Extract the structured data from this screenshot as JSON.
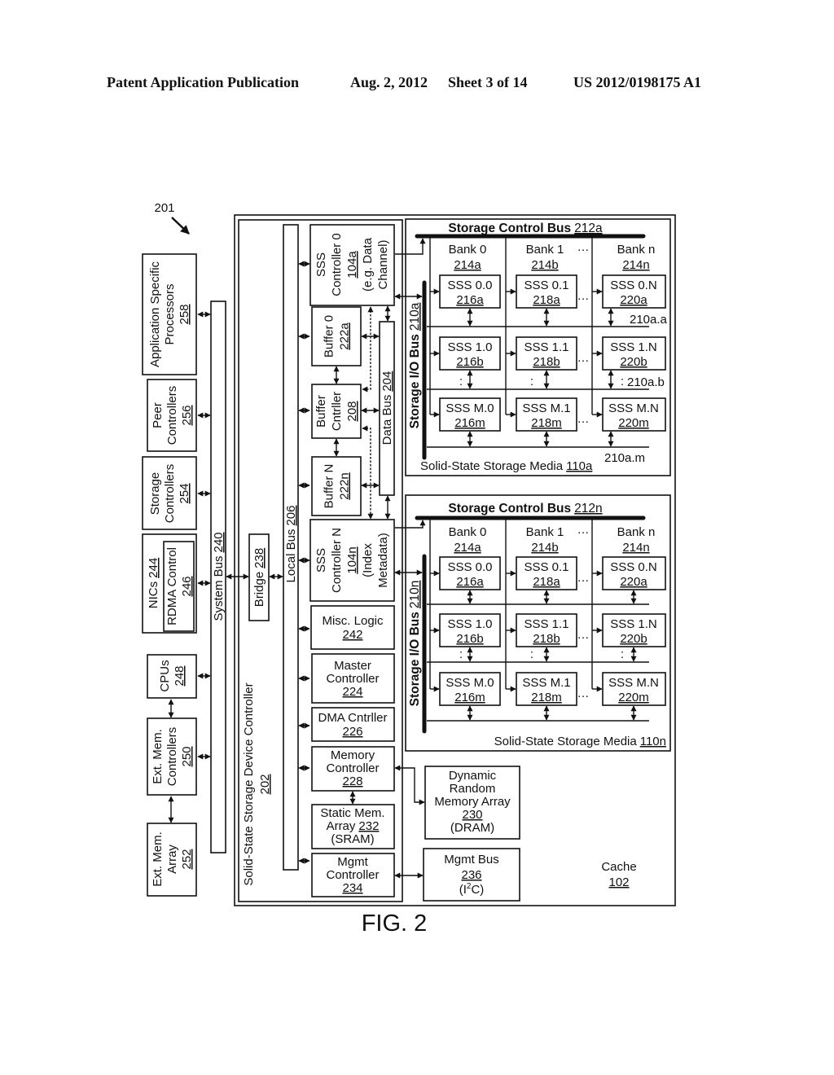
{
  "header": {
    "publication": "Patent Application Publication",
    "date": "Aug. 2, 2012",
    "sheet": "Sheet 3 of 14",
    "number": "US 2012/0198175 A1"
  },
  "figure": {
    "ref": "201",
    "caption": "FIG. 2"
  },
  "glyphs": {
    "ellipsis": "…",
    "vellipsis": ":"
  },
  "host": {
    "app_processors": {
      "lines": [
        "Application Specific",
        "Processors"
      ],
      "ref": "258"
    },
    "peer_controllers": {
      "lines": [
        "Peer",
        "Controllers"
      ],
      "ref": "256"
    },
    "storage_controllers": {
      "lines": [
        "Storage",
        "Controllers"
      ],
      "ref": "254"
    },
    "nics": {
      "label": "NICs",
      "ref": "244",
      "rdma": {
        "label": "RDMA Control",
        "ref": "246"
      }
    },
    "cpus": {
      "label": "CPUs",
      "ref": "248"
    },
    "ext_mem_controllers": {
      "lines": [
        "Ext. Mem.",
        "Controllers"
      ],
      "ref": "250"
    },
    "ext_mem_array": {
      "lines": [
        "Ext. Mem.",
        "Array"
      ],
      "ref": "252"
    },
    "system_bus": {
      "label": "System Bus",
      "ref": "240"
    }
  },
  "cache": {
    "label": "Cache",
    "ref": "102"
  },
  "ssd_controller": {
    "label": "Solid-State Storage Device Controller",
    "ref": "202",
    "bridge": {
      "label": "Bridge",
      "ref": "238"
    },
    "local_bus": {
      "label": "Local Bus",
      "ref": "206"
    },
    "sss_controller_0": {
      "lines": [
        "SSS",
        "Controller 0"
      ],
      "ref": "104a",
      "notes": [
        "(e.g. Data",
        "Channel)"
      ]
    },
    "buffer_0": {
      "label": "Buffer 0",
      "ref": "222a"
    },
    "buffer_controller": {
      "lines": [
        "Buffer",
        "Cntrller"
      ],
      "ref": "208"
    },
    "buffer_n": {
      "label": "Buffer N",
      "ref": "222n"
    },
    "data_bus": {
      "label": "Data Bus",
      "ref": "204"
    },
    "sss_controller_n": {
      "lines": [
        "SSS",
        "Controller N"
      ],
      "ref": "104n",
      "notes": [
        "(Index",
        "Metadata)"
      ]
    },
    "misc_logic": {
      "label": "Misc. Logic",
      "ref": "242"
    },
    "master_controller": {
      "lines": [
        "Master",
        "Controller"
      ],
      "ref": "224"
    },
    "dma_controller": {
      "label": "DMA Cntrller",
      "ref": "226"
    },
    "memory_controller": {
      "lines": [
        "Memory",
        "Controller"
      ],
      "ref": "228"
    },
    "sram": {
      "line1": "Static Mem.",
      "line2": "Array",
      "ref": "232",
      "note": "(SRAM)"
    },
    "mgmt_controller": {
      "lines": [
        "Mgmt",
        "Controller"
      ],
      "ref": "234"
    }
  },
  "dram": {
    "lines": [
      "Dynamic",
      "Random",
      "Memory Array"
    ],
    "ref": "230",
    "note": "(DRAM)"
  },
  "mgmt_bus": {
    "label": "Mgmt Bus",
    "ref": "236",
    "note_prefix": "(I",
    "note_sup": "2",
    "note_suffix": "C)"
  },
  "media": [
    {
      "label": "Solid-State Storage Media",
      "ref": "110a",
      "control_bus": {
        "label": "Storage Control Bus",
        "ref": "212a"
      },
      "io_bus": {
        "label": "Storage I/O Bus",
        "ref": "210a"
      },
      "banks": [
        {
          "label": "Bank 0",
          "ref": "214a"
        },
        {
          "label": "Bank 1",
          "ref": "214b"
        },
        {
          "label": "Bank n",
          "ref": "214n"
        }
      ],
      "rows": [
        [
          {
            "label": "SSS 0.0",
            "ref": "216a"
          },
          {
            "label": "SSS 0.1",
            "ref": "218a"
          },
          {
            "label": "SSS 0.N",
            "ref": "220a"
          }
        ],
        [
          {
            "label": "SSS 1.0",
            "ref": "216b"
          },
          {
            "label": "SSS 1.1",
            "ref": "218b"
          },
          {
            "label": "SSS 1.N",
            "ref": "220b"
          }
        ],
        [
          {
            "label": "SSS M.0",
            "ref": "216m"
          },
          {
            "label": "SSS M.1",
            "ref": "218m"
          },
          {
            "label": "SSS M.N",
            "ref": "220m"
          }
        ]
      ],
      "row_bus_refs": [
        "210a.a",
        "210a.b",
        "210a.m"
      ]
    },
    {
      "label": "Solid-State Storage Media",
      "ref": "110n",
      "control_bus": {
        "label": "Storage Control Bus",
        "ref": "212n"
      },
      "io_bus": {
        "label": "Storage I/O Bus",
        "ref": "210n"
      },
      "banks": [
        {
          "label": "Bank 0",
          "ref": "214a"
        },
        {
          "label": "Bank 1",
          "ref": "214b"
        },
        {
          "label": "Bank n",
          "ref": "214n"
        }
      ],
      "rows": [
        [
          {
            "label": "SSS 0.0",
            "ref": "216a"
          },
          {
            "label": "SSS 0.1",
            "ref": "218a"
          },
          {
            "label": "SSS 0.N",
            "ref": "220a"
          }
        ],
        [
          {
            "label": "SSS 1.0",
            "ref": "216b"
          },
          {
            "label": "SSS 1.1",
            "ref": "218b"
          },
          {
            "label": "SSS 1.N",
            "ref": "220b"
          }
        ],
        [
          {
            "label": "SSS M.0",
            "ref": "216m"
          },
          {
            "label": "SSS M.1",
            "ref": "218m"
          },
          {
            "label": "SSS M.N",
            "ref": "220m"
          }
        ]
      ]
    }
  ]
}
